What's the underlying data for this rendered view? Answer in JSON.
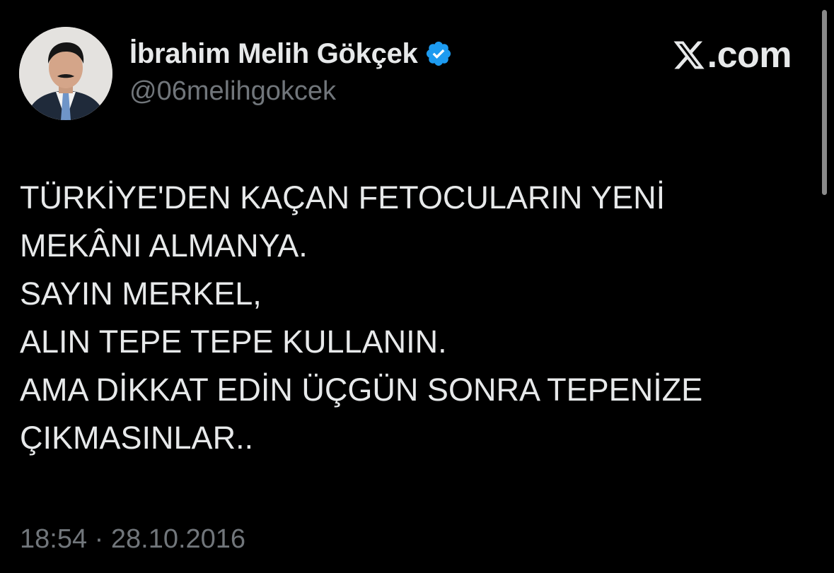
{
  "author": {
    "display_name": "İbrahim Melih Gökçek",
    "handle": "@06melihgokcek",
    "verified": true,
    "avatar_icon": "profile-photo"
  },
  "brand": {
    "text": ".com",
    "logo_icon": "x-logo-icon"
  },
  "tweet": {
    "lines": [
      "TÜRKİYE'DEN KAÇAN FETOCULARIN YENİ",
      "MEKÂNI ALMANYA.",
      "SAYIN MERKEL,",
      "ALIN TEPE TEPE KULLANIN.",
      "AMA DİKKAT EDİN ÜÇGÜN SONRA TEPENİZE",
      "ÇIKMASINLAR.."
    ],
    "timestamp": "18:54 · 28.10.2016"
  },
  "colors": {
    "background": "#000000",
    "primary_text": "#e7e9ea",
    "secondary_text": "#71767b",
    "verified_badge": "#1d9bf0"
  }
}
